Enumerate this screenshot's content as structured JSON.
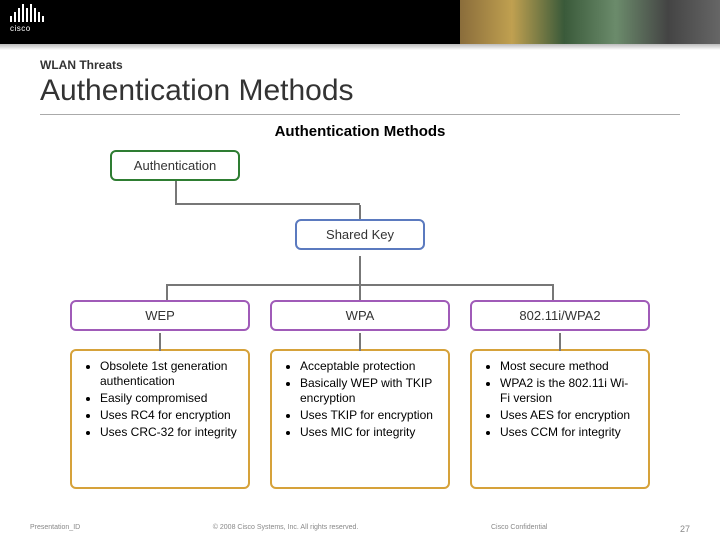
{
  "header": {
    "brand": "cisco"
  },
  "slide": {
    "kicker": "WLAN Threats",
    "title": "Authentication Methods"
  },
  "diagram": {
    "title": "Authentication Methods",
    "root": "Authentication",
    "mid": "Shared Key",
    "methods": [
      {
        "name": "WEP",
        "details": [
          "Obsolete 1st generation authentication",
          "Easily compromised",
          "Uses RC4 for encryption",
          "Uses CRC-32 for integrity"
        ]
      },
      {
        "name": "WPA",
        "details": [
          "Acceptable protection",
          "Basically WEP with TKIP encryption",
          "Uses TKIP for encryption",
          "Uses MIC for integrity"
        ]
      },
      {
        "name": "802.11i/WPA2",
        "details": [
          "Most secure method",
          "WPA2 is the 802.11i Wi-Fi version",
          "Uses AES for encryption",
          "Uses CCM for integrity"
        ]
      }
    ]
  },
  "footer": {
    "presentation_id": "Presentation_ID",
    "copyright": "© 2008 Cisco Systems, Inc. All rights reserved.",
    "confidential": "Cisco Confidential",
    "page": "27"
  }
}
